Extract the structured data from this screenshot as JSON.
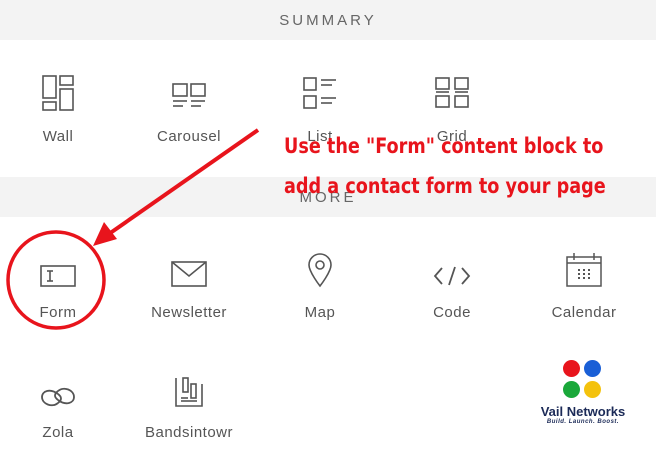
{
  "sections": {
    "summary_title": "SUMMARY",
    "more_title": "MORE"
  },
  "summary_blocks": [
    {
      "label": "Wall",
      "icon": "wall-layout-icon"
    },
    {
      "label": "Carousel",
      "icon": "carousel-layout-icon"
    },
    {
      "label": "List",
      "icon": "list-layout-icon"
    },
    {
      "label": "Grid",
      "icon": "grid-layout-icon"
    }
  ],
  "more_blocks": [
    {
      "label": "Form",
      "icon": "form-icon"
    },
    {
      "label": "Newsletter",
      "icon": "envelope-icon"
    },
    {
      "label": "Map",
      "icon": "map-pin-icon"
    },
    {
      "label": "Code",
      "icon": "code-icon"
    },
    {
      "label": "Calendar",
      "icon": "calendar-icon"
    },
    {
      "label": "Zola",
      "icon": "zola-rings-icon"
    },
    {
      "label": "Bandsintowr",
      "icon": "bandsintown-icon"
    }
  ],
  "annotation": {
    "line1": "Use the \"Form\" content block to",
    "line2": "add a contact form to your page",
    "color": "#e8141c"
  },
  "logo": {
    "name": "Vail Networks",
    "tagline": "Build. Launch. Boost.",
    "dot_colors": [
      "#e8141c",
      "#1a5fd6",
      "#1aa83a",
      "#f4c20d"
    ]
  }
}
